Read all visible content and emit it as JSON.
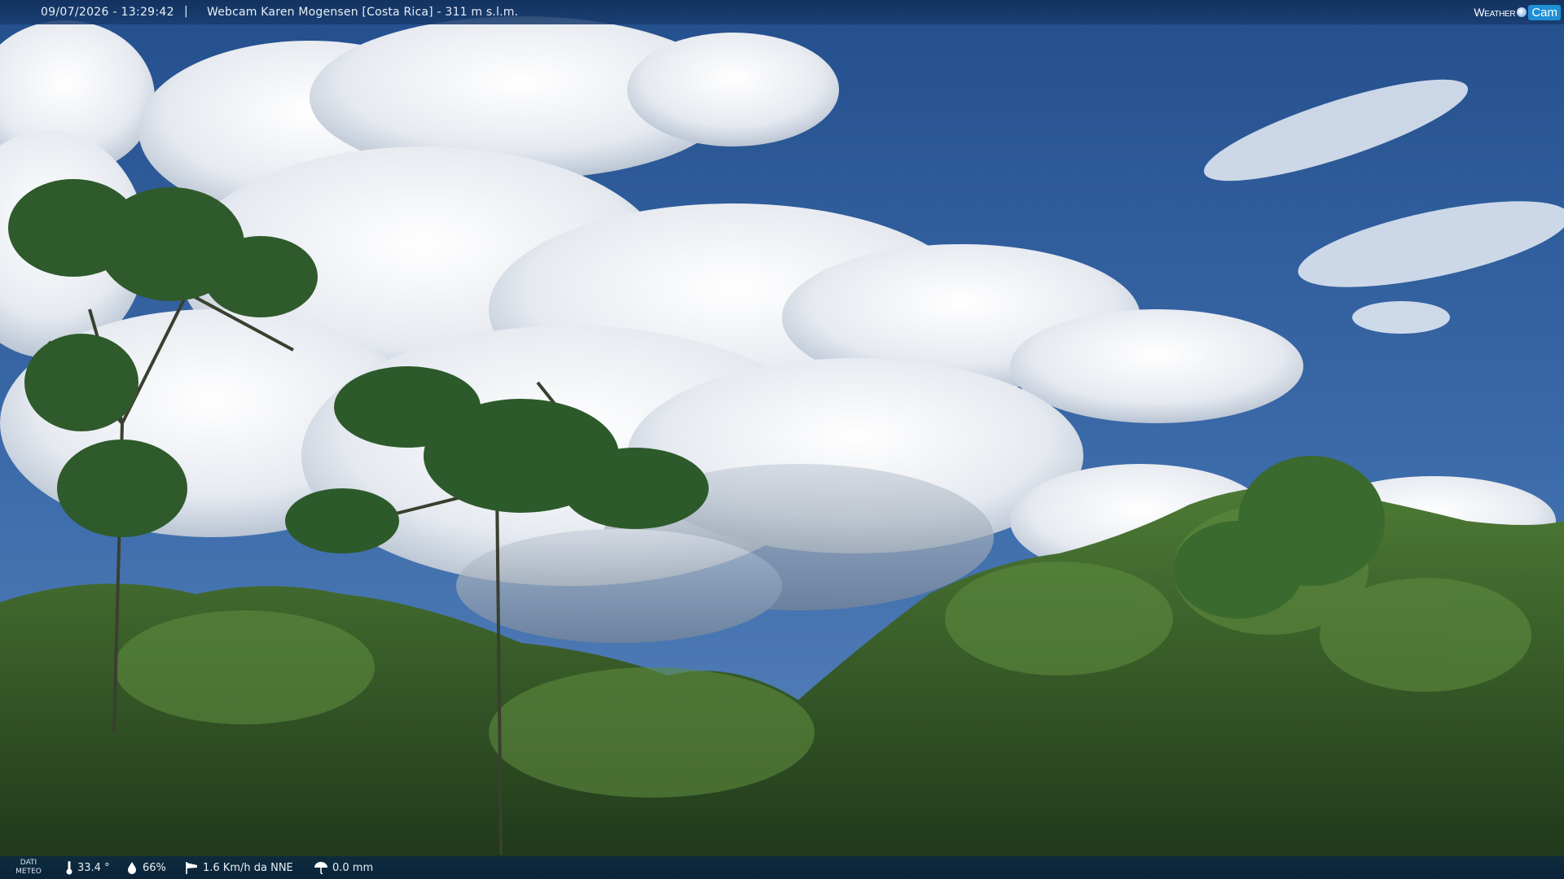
{
  "header": {
    "timestamp": "09/07/2026 - 13:29:42",
    "separator": "|",
    "title": "Webcam Karen Mogensen [Costa Rica]  - 311 m s.l.m."
  },
  "logo": {
    "weather": "Weather",
    "cam": "Cam"
  },
  "footer": {
    "dati_label_line1": "DATI",
    "dati_label_line2": "METEO",
    "temperature": "33.4 °",
    "humidity": "66%",
    "wind": "1.6 Km/h da NNE",
    "rain": "0.0 mm"
  },
  "icons": {
    "temperature": "thermometer-icon",
    "humidity": "drop-icon",
    "wind": "windsock-icon",
    "rain": "umbrella-icon"
  },
  "colors": {
    "sky_top": "#2c5896",
    "sky_mid": "#3f6fb0",
    "cloud": "#f2f4f7",
    "forest_dark": "#1f3a1c",
    "forest_light": "#4e7a33",
    "bar": "#0f2e56"
  }
}
